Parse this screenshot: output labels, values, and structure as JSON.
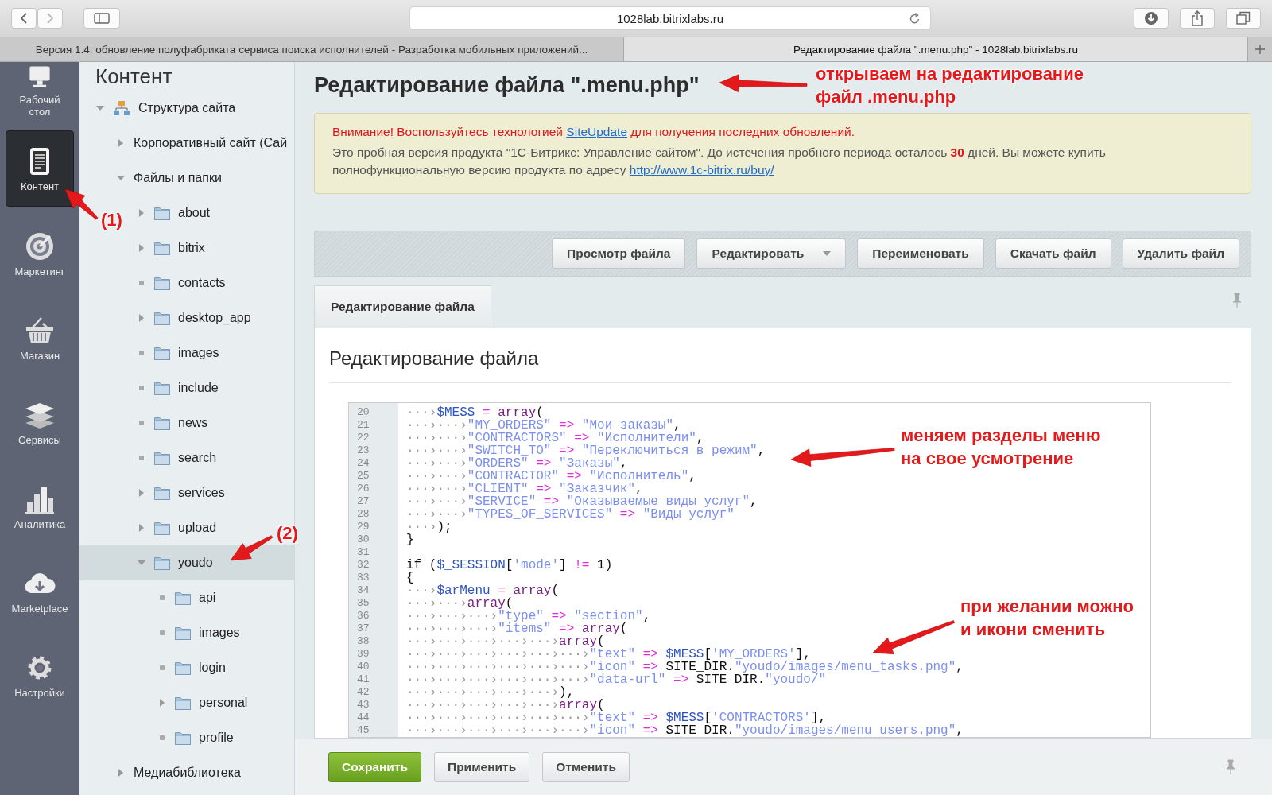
{
  "browser": {
    "url": "1028lab.bitrixlabs.ru",
    "tabs": [
      {
        "label": "Версия 1.4: обновление полуфабриката сервиса поиска исполнителей - Разработка мобильных приложений...",
        "selected": false
      },
      {
        "label": "Редактирование файла \".menu.php\" - 1028lab.bitrixlabs.ru",
        "selected": true
      }
    ]
  },
  "sidebar": {
    "items": [
      {
        "label": "Рабочий стол",
        "selected": false
      },
      {
        "label": "Контент",
        "selected": true
      },
      {
        "label": "Маркетинг",
        "selected": false
      },
      {
        "label": "Магазин",
        "selected": false
      },
      {
        "label": "Сервисы",
        "selected": false
      },
      {
        "label": "Аналитика",
        "selected": false
      },
      {
        "label": "Marketplace",
        "selected": false
      },
      {
        "label": "Настройки",
        "selected": false
      }
    ]
  },
  "tree": {
    "title": "Контент",
    "items": [
      {
        "label": "Структура сайта",
        "kind": "sitemap",
        "expanded": true,
        "selected": false,
        "children": [
          {
            "label": "Корпоративный сайт (Сай",
            "expanded": false,
            "selected": false
          },
          {
            "label": "Файлы и папки",
            "expanded": true,
            "selected": false,
            "children": [
              {
                "label": "about",
                "kind": "folder",
                "expanded": false,
                "selected": false
              },
              {
                "label": "bitrix",
                "kind": "folder",
                "expanded": false,
                "selected": false
              },
              {
                "label": "contacts",
                "kind": "folder",
                "selected": false
              },
              {
                "label": "desktop_app",
                "kind": "folder",
                "expanded": false,
                "selected": false
              },
              {
                "label": "images",
                "kind": "folder",
                "selected": false
              },
              {
                "label": "include",
                "kind": "folder",
                "selected": false
              },
              {
                "label": "news",
                "kind": "folder",
                "selected": false
              },
              {
                "label": "search",
                "kind": "folder",
                "selected": false
              },
              {
                "label": "services",
                "kind": "folder",
                "expanded": false,
                "selected": false
              },
              {
                "label": "upload",
                "kind": "folder",
                "expanded": false,
                "selected": false
              },
              {
                "label": "youdo",
                "kind": "folder",
                "expanded": true,
                "selected": true,
                "children": [
                  {
                    "label": "api",
                    "kind": "folder",
                    "selected": false
                  },
                  {
                    "label": "images",
                    "kind": "folder",
                    "selected": false
                  },
                  {
                    "label": "login",
                    "kind": "folder",
                    "selected": false
                  },
                  {
                    "label": "personal",
                    "kind": "folder",
                    "expanded": false,
                    "selected": false
                  },
                  {
                    "label": "profile",
                    "kind": "folder",
                    "selected": false
                  }
                ]
              }
            ]
          },
          {
            "label": "Медиабиблиотека",
            "expanded": false,
            "selected": false
          }
        ]
      }
    ]
  },
  "page": {
    "title": "Редактирование файла \".menu.php\"",
    "notice": {
      "warning_before": "Внимание! Воспользуйтесь технологией",
      "warning_link": "SiteUpdate",
      "warning_after": "для получения последних обновлений.",
      "text": "Это пробная версия продукта \"1С-Битрикс: Управление сайтом\". До истечения пробного периода осталось **30** дней. Вы можете купить полнофункциональную версию продукта по адресу",
      "link": "http://www.1c-bitrix.ru/buy/"
    },
    "toolbar": [
      {
        "label": "Просмотр файла",
        "kind": "plain"
      },
      {
        "label": "Редактировать",
        "kind": "dropdown"
      },
      {
        "label": "Переименовать",
        "kind": "plain"
      },
      {
        "label": "Скачать файл",
        "kind": "plain"
      },
      {
        "label": "Удалить файл",
        "kind": "plain"
      }
    ],
    "tab": "Редактирование файла",
    "heading": "Редактирование файла",
    "code": [
      {
        "number": "20",
        "tokens": [
          {
            "kind": "ws",
            "text": "···›"
          },
          {
            "kind": "var",
            "text": "$MESS"
          },
          {
            "kind": "op",
            "text": " = "
          },
          {
            "kind": "kw",
            "text": "array"
          },
          {
            "kind": "plain",
            "text": "("
          }
        ]
      },
      {
        "number": "21",
        "tokens": [
          {
            "kind": "ws",
            "text": "···›···›"
          },
          {
            "kind": "str",
            "text": "\"MY_ORDERS\""
          },
          {
            "kind": "op",
            "text": " => "
          },
          {
            "kind": "str",
            "text": "\"Мои заказы\""
          },
          {
            "kind": "plain",
            "text": ","
          }
        ]
      },
      {
        "number": "22",
        "tokens": [
          {
            "kind": "ws",
            "text": "···›···›"
          },
          {
            "kind": "str",
            "text": "\"CONTRACTORS\""
          },
          {
            "kind": "op",
            "text": " => "
          },
          {
            "kind": "str",
            "text": "\"Исполнители\""
          },
          {
            "kind": "plain",
            "text": ","
          }
        ]
      },
      {
        "number": "23",
        "tokens": [
          {
            "kind": "ws",
            "text": "···›···›"
          },
          {
            "kind": "str",
            "text": "\"SWITCH_TO\""
          },
          {
            "kind": "op",
            "text": " => "
          },
          {
            "kind": "str",
            "text": "\"Переключиться в режим\""
          },
          {
            "kind": "plain",
            "text": ","
          }
        ]
      },
      {
        "number": "24",
        "tokens": [
          {
            "kind": "ws",
            "text": "···›···›"
          },
          {
            "kind": "str",
            "text": "\"ORDERS\""
          },
          {
            "kind": "op",
            "text": " => "
          },
          {
            "kind": "str",
            "text": "\"Заказы\""
          },
          {
            "kind": "plain",
            "text": ","
          }
        ]
      },
      {
        "number": "25",
        "tokens": [
          {
            "kind": "ws",
            "text": "···›···›"
          },
          {
            "kind": "str",
            "text": "\"CONTRACTOR\""
          },
          {
            "kind": "op",
            "text": " => "
          },
          {
            "kind": "str",
            "text": "\"Исполнитель\""
          },
          {
            "kind": "plain",
            "text": ","
          }
        ]
      },
      {
        "number": "26",
        "tokens": [
          {
            "kind": "ws",
            "text": "···›···›"
          },
          {
            "kind": "str",
            "text": "\"CLIENT\""
          },
          {
            "kind": "op",
            "text": " => "
          },
          {
            "kind": "str",
            "text": "\"Заказчик\""
          },
          {
            "kind": "plain",
            "text": ","
          }
        ]
      },
      {
        "number": "27",
        "tokens": [
          {
            "kind": "ws",
            "text": "···›···›"
          },
          {
            "kind": "str",
            "text": "\"SERVICE\""
          },
          {
            "kind": "op",
            "text": " => "
          },
          {
            "kind": "str",
            "text": "\"Оказываемые виды услуг\""
          },
          {
            "kind": "plain",
            "text": ","
          }
        ]
      },
      {
        "number": "28",
        "tokens": [
          {
            "kind": "ws",
            "text": "···›···›"
          },
          {
            "kind": "str",
            "text": "\"TYPES_OF_SERVICES\""
          },
          {
            "kind": "op",
            "text": " => "
          },
          {
            "kind": "str",
            "text": "\"Виды услуг\""
          }
        ]
      },
      {
        "number": "29",
        "tokens": [
          {
            "kind": "ws",
            "text": "···›"
          },
          {
            "kind": "plain",
            "text": ");"
          }
        ]
      },
      {
        "number": "30",
        "tokens": [
          {
            "kind": "plain",
            "text": "}"
          }
        ]
      },
      {
        "number": "31"
      },
      {
        "number": "32",
        "tokens": [
          {
            "kind": "plain",
            "text": "if ("
          },
          {
            "kind": "var",
            "text": "$_SESSION"
          },
          {
            "kind": "plain",
            "text": "["
          },
          {
            "kind": "str",
            "text": "'mode'"
          },
          {
            "kind": "plain",
            "text": "] "
          },
          {
            "kind": "op",
            "text": "!="
          },
          {
            "kind": "plain",
            "text": " 1)"
          }
        ]
      },
      {
        "number": "33",
        "tokens": [
          {
            "kind": "plain",
            "text": "{"
          }
        ]
      },
      {
        "number": "34",
        "tokens": [
          {
            "kind": "ws",
            "text": "···›"
          },
          {
            "kind": "var",
            "text": "$arMenu"
          },
          {
            "kind": "op",
            "text": " = "
          },
          {
            "kind": "kw",
            "text": "array"
          },
          {
            "kind": "plain",
            "text": "("
          }
        ]
      },
      {
        "number": "35",
        "tokens": [
          {
            "kind": "ws",
            "text": "···›···›"
          },
          {
            "kind": "kw",
            "text": "array"
          },
          {
            "kind": "plain",
            "text": "("
          }
        ]
      },
      {
        "number": "36",
        "tokens": [
          {
            "kind": "ws",
            "text": "···›···›···›"
          },
          {
            "kind": "str",
            "text": "\"type\""
          },
          {
            "kind": "op",
            "text": " => "
          },
          {
            "kind": "str",
            "text": "\"section\""
          },
          {
            "kind": "plain",
            "text": ","
          }
        ]
      },
      {
        "number": "37",
        "tokens": [
          {
            "kind": "ws",
            "text": "···›···›···›"
          },
          {
            "kind": "str",
            "text": "\"items\""
          },
          {
            "kind": "op",
            "text": " => "
          },
          {
            "kind": "kw",
            "text": "array"
          },
          {
            "kind": "plain",
            "text": "("
          }
        ]
      },
      {
        "number": "38",
        "tokens": [
          {
            "kind": "ws",
            "text": "···›···›···›···›···›"
          },
          {
            "kind": "kw",
            "text": "array"
          },
          {
            "kind": "plain",
            "text": "("
          }
        ]
      },
      {
        "number": "39",
        "tokens": [
          {
            "kind": "ws",
            "text": "···›···›···›···›···›···›"
          },
          {
            "kind": "str",
            "text": "\"text\""
          },
          {
            "kind": "op",
            "text": " => "
          },
          {
            "kind": "var",
            "text": "$MESS"
          },
          {
            "kind": "plain",
            "text": "["
          },
          {
            "kind": "str",
            "text": "'MY_ORDERS'"
          },
          {
            "kind": "plain",
            "text": "],"
          }
        ]
      },
      {
        "number": "40",
        "tokens": [
          {
            "kind": "ws",
            "text": "···›···›···›···›···›···›"
          },
          {
            "kind": "str",
            "text": "\"icon\""
          },
          {
            "kind": "op",
            "text": " => "
          },
          {
            "kind": "plain",
            "text": "SITE_DIR."
          },
          {
            "kind": "str",
            "text": "\"youdo/images/menu_tasks.png\""
          },
          {
            "kind": "plain",
            "text": ","
          }
        ]
      },
      {
        "number": "41",
        "tokens": [
          {
            "kind": "ws",
            "text": "···›···›···›···›···›···›"
          },
          {
            "kind": "str",
            "text": "\"data-url\""
          },
          {
            "kind": "op",
            "text": " => "
          },
          {
            "kind": "plain",
            "text": "SITE_DIR."
          },
          {
            "kind": "str",
            "text": "\"youdo/\""
          }
        ]
      },
      {
        "number": "42",
        "tokens": [
          {
            "kind": "ws",
            "text": "···›···›···›···›···›"
          },
          {
            "kind": "plain",
            "text": "),"
          }
        ]
      },
      {
        "number": "43",
        "tokens": [
          {
            "kind": "ws",
            "text": "···›···›···›···›···›"
          },
          {
            "kind": "kw",
            "text": "array"
          },
          {
            "kind": "plain",
            "text": "("
          }
        ]
      },
      {
        "number": "44",
        "tokens": [
          {
            "kind": "ws",
            "text": "···›···›···›···›···›···›"
          },
          {
            "kind": "str",
            "text": "\"text\""
          },
          {
            "kind": "op",
            "text": " => "
          },
          {
            "kind": "var",
            "text": "$MESS"
          },
          {
            "kind": "plain",
            "text": "["
          },
          {
            "kind": "str",
            "text": "'CONTRACTORS'"
          },
          {
            "kind": "plain",
            "text": "],"
          }
        ]
      },
      {
        "number": "45",
        "tokens": [
          {
            "kind": "ws",
            "text": "···›···›···›···›···›···›"
          },
          {
            "kind": "str",
            "text": "\"icon\""
          },
          {
            "kind": "op",
            "text": " => "
          },
          {
            "kind": "plain",
            "text": "SITE_DIR."
          },
          {
            "kind": "str",
            "text": "\"youdo/images/menu_users.png\""
          },
          {
            "kind": "plain",
            "text": ","
          }
        ]
      }
    ],
    "footer": [
      {
        "label": "Сохранить",
        "kind": "primary"
      },
      {
        "label": "Применить",
        "kind": "plain"
      },
      {
        "label": "Отменить",
        "kind": "plain"
      }
    ]
  },
  "annotations": [
    {
      "lines": [
        "(1)"
      ]
    },
    {
      "lines": [
        "(2)"
      ]
    },
    {
      "lines": [
        "открываем на редактирование",
        "файл .menu.php"
      ]
    },
    {
      "lines": [
        "меняем разделы меню",
        "на свое усмотрение"
      ]
    },
    {
      "lines": [
        "при желании можно",
        "и икони сменить"
      ]
    }
  ]
}
